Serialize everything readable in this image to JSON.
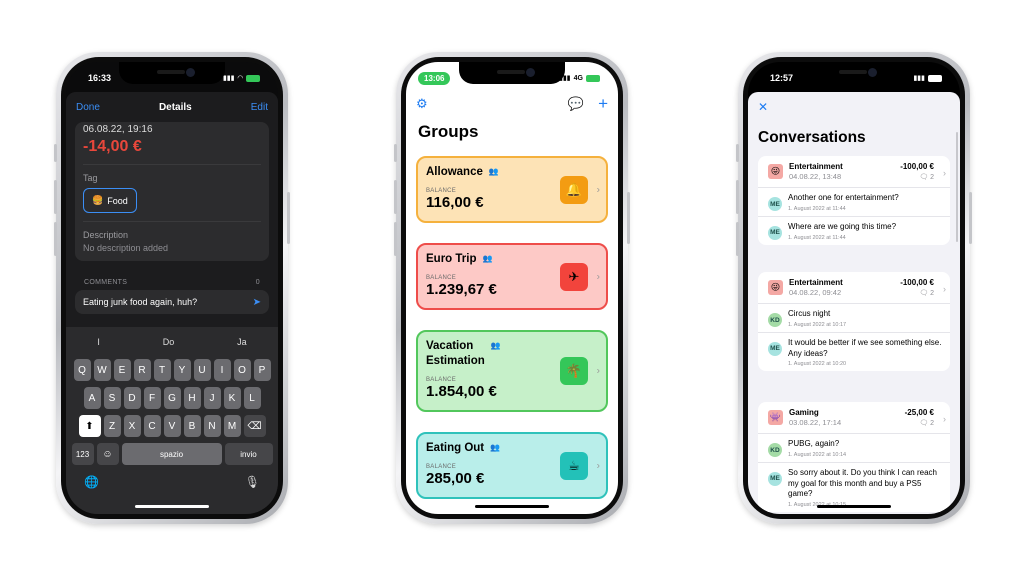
{
  "phone1": {
    "time": "16:33",
    "nav": {
      "done": "Done",
      "title": "Details",
      "edit": "Edit"
    },
    "date": "06.08.22, 19:16",
    "amount": "-14,00 €",
    "tag_label": "Tag",
    "tag_value": "Food",
    "tag_emoji": "🍔",
    "description_label": "Description",
    "description_value": "No description added",
    "comments_label": "COMMENTS",
    "comments_count": "0",
    "comment_input": "Eating junk food again, huh?",
    "suggestions": [
      "I",
      "Do",
      "Ja"
    ],
    "keys_row1": [
      "Q",
      "W",
      "E",
      "R",
      "T",
      "Y",
      "U",
      "I",
      "O",
      "P"
    ],
    "keys_row2": [
      "A",
      "S",
      "D",
      "F",
      "G",
      "H",
      "J",
      "K",
      "L"
    ],
    "keys_row3": [
      "Z",
      "X",
      "C",
      "V",
      "B",
      "N",
      "M"
    ],
    "key_123": "123",
    "key_space": "spazio",
    "key_return": "invio"
  },
  "phone2": {
    "time": "13:06",
    "network": "4G",
    "title": "Groups",
    "balance_label": "BALANCE",
    "groups": [
      {
        "name_line1": "Allowance",
        "name_line2": "",
        "balance": "116,00 €",
        "icon": "🔔",
        "bg": "#fde3b6",
        "border": "#f5b13d",
        "icon_bg": "#f39c12"
      },
      {
        "name_line1": "Euro Trip",
        "name_line2": "",
        "balance": "1.239,67 €",
        "icon": "✈",
        "bg": "#fdc9c6",
        "border": "#ee4d4a",
        "icon_bg": "#f2443c"
      },
      {
        "name_line1": "Vacation",
        "name_line2": "Estimation",
        "balance": "1.854,00 €",
        "icon": "🌴",
        "bg": "#c6f0c9",
        "border": "#52c75c",
        "icon_bg": "#34c759"
      },
      {
        "name_line1": "Eating Out",
        "name_line2": "",
        "balance": "285,00 €",
        "icon": "☕",
        "bg": "#b9eeea",
        "border": "#2fc2bb",
        "icon_bg": "#23c1b8"
      }
    ]
  },
  "phone3": {
    "time": "12:57",
    "title": "Conversations",
    "conversations": [
      {
        "category": "Entertainment",
        "date": "04.08.22, 13:48",
        "amount": "-100,00 €",
        "count": "2",
        "icon": "😜",
        "messages": [
          {
            "initials": "ME",
            "text": "Another one for entertainment?",
            "date": "1. August 2022 at 11:44"
          },
          {
            "initials": "ME",
            "text": "Where are we going this time?",
            "date": "1. August 2022 at 11:44"
          }
        ]
      },
      {
        "category": "Entertainment",
        "date": "04.08.22, 09:42",
        "amount": "-100,00 €",
        "count": "2",
        "icon": "😜",
        "messages": [
          {
            "initials": "KD",
            "text": "Circus night",
            "date": "1. August 2022 at 10:17"
          },
          {
            "initials": "ME",
            "text": "It would be better if we see something else. Any ideas?",
            "date": "1. August 2022 at 10:20"
          }
        ]
      },
      {
        "category": "Gaming",
        "date": "03.08.22, 17:14",
        "amount": "-25,00 €",
        "count": "2",
        "icon": "👾",
        "messages": [
          {
            "initials": "KD",
            "text": "PUBG, again?",
            "date": "1. August 2022 at 10:14"
          },
          {
            "initials": "ME",
            "text": "So sorry about it. Do you think I can reach my goal for this month and buy a PS5 game?",
            "date": "1. August 2022 at 10:15"
          }
        ]
      }
    ]
  },
  "colors": {
    "accent": "#1e7cf2",
    "negative": "#e9473b"
  }
}
